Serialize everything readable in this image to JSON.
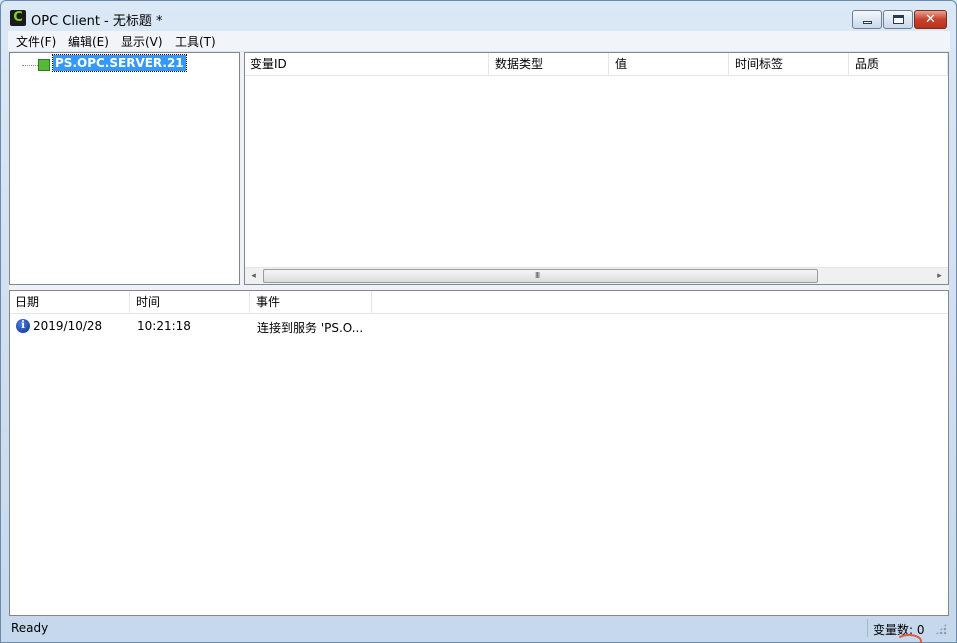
{
  "window": {
    "title": "OPC Client - 无标题 *",
    "app_icon_letter": "C",
    "close_glyph": "✕"
  },
  "menu": {
    "items": [
      "文件(F)",
      "编辑(E)",
      "显示(V)",
      "工具(T)"
    ]
  },
  "tree": {
    "selected_node": "PS.OPC.SERVER.21"
  },
  "item_list": {
    "columns": [
      "变量ID",
      "数据类型",
      "值",
      "时间标签",
      "品质"
    ],
    "rows": [],
    "scroll_left": "◂",
    "scroll_right": "▸",
    "grip": "III"
  },
  "event_log": {
    "columns": [
      "日期",
      "时间",
      "事件"
    ],
    "rows": [
      {
        "icon": "info-icon",
        "date": "2019/10/28",
        "time": "10:21:18",
        "event": "连接到服务 'PS.O..."
      }
    ]
  },
  "status": {
    "text": "Ready",
    "count": "变量数: 0"
  },
  "colors": {
    "selection": "#3399ff",
    "close_button": "#c7412c",
    "server_icon": "#55b93a"
  }
}
